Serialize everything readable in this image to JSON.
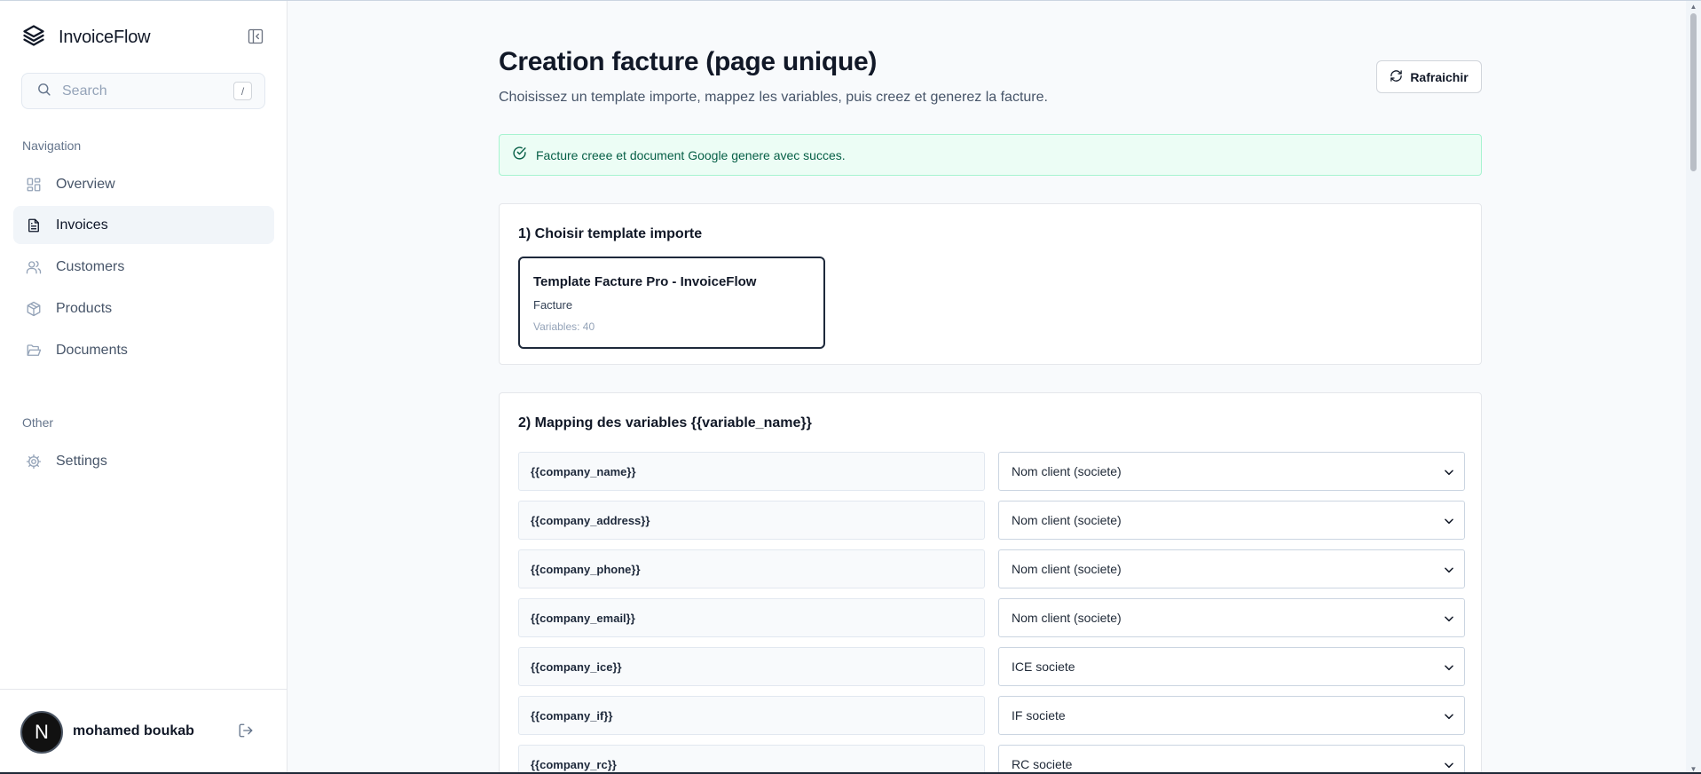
{
  "app": {
    "name": "InvoiceFlow"
  },
  "search": {
    "placeholder": "Search",
    "shortcut": "/"
  },
  "sidebar": {
    "nav_label": "Navigation",
    "items": [
      {
        "label": "Overview",
        "icon": "layout-grid-icon"
      },
      {
        "label": "Invoices",
        "icon": "file-text-icon",
        "active": true
      },
      {
        "label": "Customers",
        "icon": "users-icon"
      },
      {
        "label": "Products",
        "icon": "box-icon"
      },
      {
        "label": "Documents",
        "icon": "folder-open-icon"
      }
    ],
    "other_label": "Other",
    "other_items": [
      {
        "label": "Settings",
        "icon": "gear-icon"
      }
    ]
  },
  "user": {
    "initial": "N",
    "name": "mohamed boukab"
  },
  "page": {
    "title": "Creation facture (page unique)",
    "subtitle": "Choisissez un template importe, mappez les variables, puis creez et generez la facture.",
    "refresh_label": "Rafraichir"
  },
  "alert": {
    "message": "Facture creee et document Google genere avec succes."
  },
  "step1": {
    "title": "1) Choisir template importe",
    "template": {
      "name": "Template Facture Pro - InvoiceFlow",
      "type": "Facture",
      "variables": "Variables: 40"
    }
  },
  "step2": {
    "title": "2) Mapping des variables {{variable_name}}",
    "rows": [
      {
        "variable": "{{company_name}}",
        "mapping": "Nom client (societe)"
      },
      {
        "variable": "{{company_address}}",
        "mapping": "Nom client (societe)"
      },
      {
        "variable": "{{company_phone}}",
        "mapping": "Nom client (societe)"
      },
      {
        "variable": "{{company_email}}",
        "mapping": "Nom client (societe)"
      },
      {
        "variable": "{{company_ice}}",
        "mapping": "ICE societe"
      },
      {
        "variable": "{{company_if}}",
        "mapping": "IF societe"
      },
      {
        "variable": "{{company_rc}}",
        "mapping": "RC societe"
      }
    ]
  },
  "colors": {
    "primary": "#0f172a",
    "success_bg": "#ecfdf5",
    "success_text": "#065f46"
  }
}
